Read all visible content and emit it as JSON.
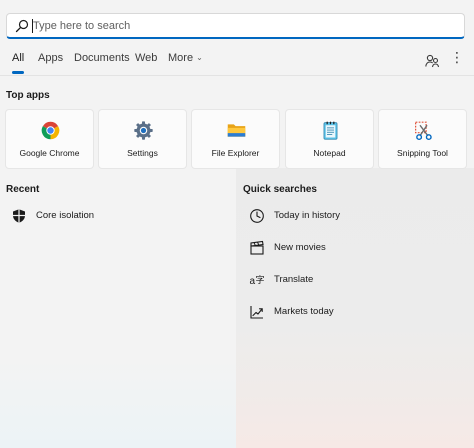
{
  "search": {
    "placeholder": "Type here to search",
    "value": ""
  },
  "tabs": [
    {
      "label": "All",
      "active": true
    },
    {
      "label": "Apps"
    },
    {
      "label": "Documents"
    },
    {
      "label": "Web"
    },
    {
      "label": "More"
    }
  ],
  "top_apps": {
    "title": "Top apps",
    "items": [
      {
        "label": "Google Chrome",
        "icon": "chrome-icon"
      },
      {
        "label": "Settings",
        "icon": "gear-icon"
      },
      {
        "label": "File Explorer",
        "icon": "folder-icon"
      },
      {
        "label": "Notepad",
        "icon": "notepad-icon"
      },
      {
        "label": "Snipping Tool",
        "icon": "scissors-icon"
      }
    ]
  },
  "recent": {
    "title": "Recent",
    "items": [
      {
        "label": "Core isolation",
        "icon": "shield-icon"
      }
    ]
  },
  "quick_searches": {
    "title": "Quick searches",
    "items": [
      {
        "label": "Today in history",
        "icon": "clock-icon"
      },
      {
        "label": "New movies",
        "icon": "clapperboard-icon"
      },
      {
        "label": "Translate",
        "icon": "translate-icon"
      },
      {
        "label": "Markets today",
        "icon": "chart-trend-icon"
      }
    ]
  },
  "colors": {
    "accent": "#0067c0",
    "background": "#f3f3f3",
    "tile": "#fbfbfb"
  }
}
